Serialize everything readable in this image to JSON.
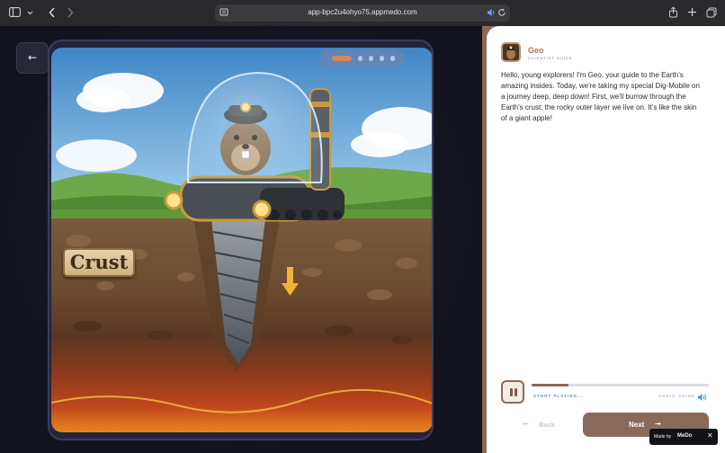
{
  "browser": {
    "url": "app-bpc2u4ohyo75.appmedo.com",
    "icons": [
      "sidebar-icon",
      "chevron-down-icon",
      "back-icon",
      "forward-icon",
      "reader-icon",
      "speaker-icon",
      "reload-icon",
      "share-icon",
      "plus-icon",
      "tabs-icon"
    ]
  },
  "stage": {
    "back_glyph": "←",
    "slide_progress": {
      "total": 5,
      "current": 1
    },
    "layer_label": "Crust"
  },
  "guide": {
    "name": "Geo",
    "role": "SCIENTIST GUIDE",
    "story": "Hello, young explorers! I'm Geo, your guide to the Earth's amazing insides. Today, we're taking my special Dig-Mobile on a journey deep, deep down! First, we'll burrow through the Earth's crust, the rocky outer layer we live on. It's like the skin of a giant apple!"
  },
  "audio": {
    "status": "STORY PLAYING...",
    "guide_label": "AUDIO GUIDE",
    "progress": 0.21
  },
  "nav": {
    "back_label": "Back",
    "next_label": "Next",
    "back_arrow": "←",
    "next_arrow": "→"
  },
  "badge": {
    "made_by": "Made by",
    "brand": "MeDo",
    "close_glyph": "✕"
  },
  "colors": {
    "accent": "#8a6a5a",
    "status_blue": "#4a90c8",
    "progress_active": "#d08a57"
  }
}
